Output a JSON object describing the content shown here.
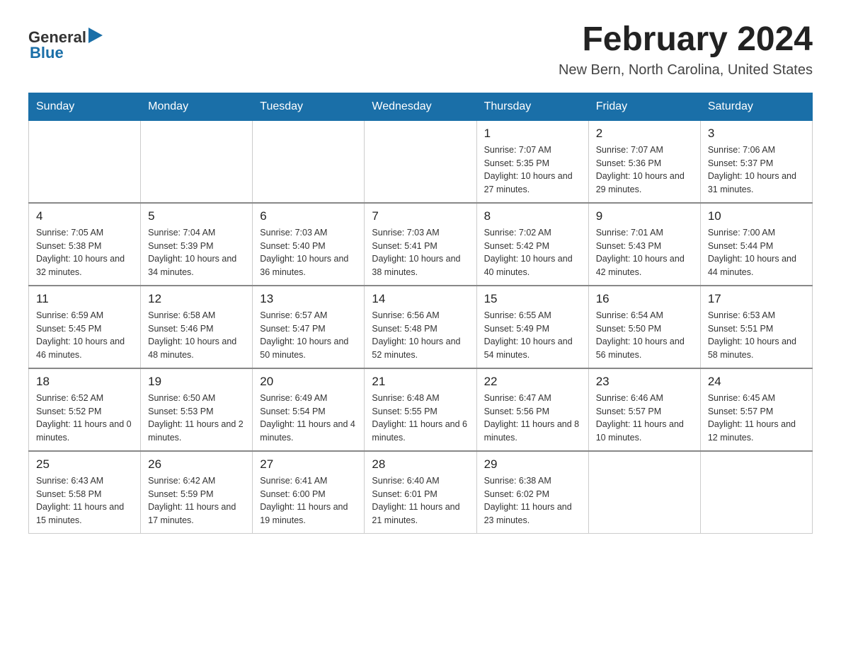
{
  "header": {
    "logo_general": "General",
    "logo_blue": "Blue",
    "month_title": "February 2024",
    "location": "New Bern, North Carolina, United States"
  },
  "weekdays": [
    "Sunday",
    "Monday",
    "Tuesday",
    "Wednesday",
    "Thursday",
    "Friday",
    "Saturday"
  ],
  "weeks": [
    [
      {
        "day": "",
        "info": ""
      },
      {
        "day": "",
        "info": ""
      },
      {
        "day": "",
        "info": ""
      },
      {
        "day": "",
        "info": ""
      },
      {
        "day": "1",
        "info": "Sunrise: 7:07 AM\nSunset: 5:35 PM\nDaylight: 10 hours\nand 27 minutes."
      },
      {
        "day": "2",
        "info": "Sunrise: 7:07 AM\nSunset: 5:36 PM\nDaylight: 10 hours\nand 29 minutes."
      },
      {
        "day": "3",
        "info": "Sunrise: 7:06 AM\nSunset: 5:37 PM\nDaylight: 10 hours\nand 31 minutes."
      }
    ],
    [
      {
        "day": "4",
        "info": "Sunrise: 7:05 AM\nSunset: 5:38 PM\nDaylight: 10 hours\nand 32 minutes."
      },
      {
        "day": "5",
        "info": "Sunrise: 7:04 AM\nSunset: 5:39 PM\nDaylight: 10 hours\nand 34 minutes."
      },
      {
        "day": "6",
        "info": "Sunrise: 7:03 AM\nSunset: 5:40 PM\nDaylight: 10 hours\nand 36 minutes."
      },
      {
        "day": "7",
        "info": "Sunrise: 7:03 AM\nSunset: 5:41 PM\nDaylight: 10 hours\nand 38 minutes."
      },
      {
        "day": "8",
        "info": "Sunrise: 7:02 AM\nSunset: 5:42 PM\nDaylight: 10 hours\nand 40 minutes."
      },
      {
        "day": "9",
        "info": "Sunrise: 7:01 AM\nSunset: 5:43 PM\nDaylight: 10 hours\nand 42 minutes."
      },
      {
        "day": "10",
        "info": "Sunrise: 7:00 AM\nSunset: 5:44 PM\nDaylight: 10 hours\nand 44 minutes."
      }
    ],
    [
      {
        "day": "11",
        "info": "Sunrise: 6:59 AM\nSunset: 5:45 PM\nDaylight: 10 hours\nand 46 minutes."
      },
      {
        "day": "12",
        "info": "Sunrise: 6:58 AM\nSunset: 5:46 PM\nDaylight: 10 hours\nand 48 minutes."
      },
      {
        "day": "13",
        "info": "Sunrise: 6:57 AM\nSunset: 5:47 PM\nDaylight: 10 hours\nand 50 minutes."
      },
      {
        "day": "14",
        "info": "Sunrise: 6:56 AM\nSunset: 5:48 PM\nDaylight: 10 hours\nand 52 minutes."
      },
      {
        "day": "15",
        "info": "Sunrise: 6:55 AM\nSunset: 5:49 PM\nDaylight: 10 hours\nand 54 minutes."
      },
      {
        "day": "16",
        "info": "Sunrise: 6:54 AM\nSunset: 5:50 PM\nDaylight: 10 hours\nand 56 minutes."
      },
      {
        "day": "17",
        "info": "Sunrise: 6:53 AM\nSunset: 5:51 PM\nDaylight: 10 hours\nand 58 minutes."
      }
    ],
    [
      {
        "day": "18",
        "info": "Sunrise: 6:52 AM\nSunset: 5:52 PM\nDaylight: 11 hours\nand 0 minutes."
      },
      {
        "day": "19",
        "info": "Sunrise: 6:50 AM\nSunset: 5:53 PM\nDaylight: 11 hours\nand 2 minutes."
      },
      {
        "day": "20",
        "info": "Sunrise: 6:49 AM\nSunset: 5:54 PM\nDaylight: 11 hours\nand 4 minutes."
      },
      {
        "day": "21",
        "info": "Sunrise: 6:48 AM\nSunset: 5:55 PM\nDaylight: 11 hours\nand 6 minutes."
      },
      {
        "day": "22",
        "info": "Sunrise: 6:47 AM\nSunset: 5:56 PM\nDaylight: 11 hours\nand 8 minutes."
      },
      {
        "day": "23",
        "info": "Sunrise: 6:46 AM\nSunset: 5:57 PM\nDaylight: 11 hours\nand 10 minutes."
      },
      {
        "day": "24",
        "info": "Sunrise: 6:45 AM\nSunset: 5:57 PM\nDaylight: 11 hours\nand 12 minutes."
      }
    ],
    [
      {
        "day": "25",
        "info": "Sunrise: 6:43 AM\nSunset: 5:58 PM\nDaylight: 11 hours\nand 15 minutes."
      },
      {
        "day": "26",
        "info": "Sunrise: 6:42 AM\nSunset: 5:59 PM\nDaylight: 11 hours\nand 17 minutes."
      },
      {
        "day": "27",
        "info": "Sunrise: 6:41 AM\nSunset: 6:00 PM\nDaylight: 11 hours\nand 19 minutes."
      },
      {
        "day": "28",
        "info": "Sunrise: 6:40 AM\nSunset: 6:01 PM\nDaylight: 11 hours\nand 21 minutes."
      },
      {
        "day": "29",
        "info": "Sunrise: 6:38 AM\nSunset: 6:02 PM\nDaylight: 11 hours\nand 23 minutes."
      },
      {
        "day": "",
        "info": ""
      },
      {
        "day": "",
        "info": ""
      }
    ]
  ]
}
